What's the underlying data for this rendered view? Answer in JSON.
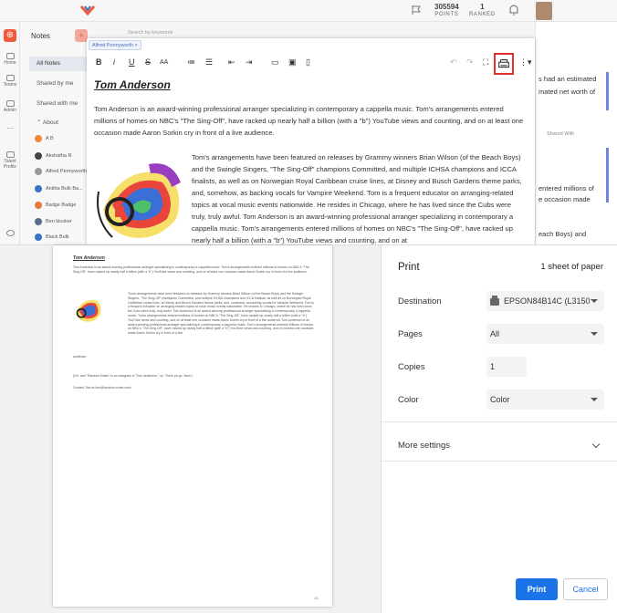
{
  "header": {
    "points_value": "305594",
    "points_label": "POINTS",
    "rank_value": "1",
    "rank_label": "RANKED"
  },
  "leftbar": {
    "items": [
      "Home",
      "Teams",
      "Admin",
      "...",
      "Talent Profile"
    ]
  },
  "sidebar": {
    "title": "Notes",
    "nav": [
      "All Notes",
      "Shared by me",
      "Shared with me"
    ],
    "about_label": "About",
    "users": [
      {
        "initials": "AB",
        "name": "A B",
        "color": "#f08a3b"
      },
      {
        "initials": "AR",
        "name": "Akshatha R",
        "color": "#444"
      },
      {
        "initials": "AP",
        "name": "Alfred Pennyworth",
        "color": "#888"
      },
      {
        "initials": "AB",
        "name": "Anitha Bulk Ba...",
        "color": "#3a72c4"
      },
      {
        "initials": "BB",
        "name": "Badge Badge",
        "color": "#e07b3a"
      },
      {
        "initials": "BK",
        "name": "Ben kiosker",
        "color": "#5a6a8a"
      },
      {
        "initials": "BB",
        "name": "Black Bulk",
        "color": "#3a72c4"
      }
    ]
  },
  "search_placeholder": "Search by keywords",
  "right_pane": {
    "line1": "s had an estimated",
    "line2": "mated net worth of",
    "shared_with": "Shared With",
    "line3": "entered millions of",
    "line4": "e occasion made",
    "line5": "each Boys) and"
  },
  "editor": {
    "chip": "Alfred Pennyworth",
    "toolbar": {
      "bold": "B",
      "italic": "i",
      "underline": "U",
      "strike": "S",
      "fontsize": "AA"
    },
    "title": "Tom Anderson",
    "para1": "Tom Anderson is an award-winning professional arranger specializing in contemporary a cappella music. Tom's arrangements entered millions of homes on NBC's \"The Sing-Off\", have racked up nearly half a billion (with a \"b\") YouTube views and counting, and on at least one occasion made Aaron Sorkin cry in front of a live audience.",
    "para2": "Tom's arrangements have been featured on releases by Grammy winners Brian Wilson (of the Beach Boys) and the Swingle Singers, \"The Sing-Off\" champions Committed, and multiple ICHSA champions and ICCA finalists, as well as on Norwegian Royal Caribbean cruise lines, at Disney and Busch Gardens theme parks, and, somehow, as backing vocals for Vampire Weekend. Tom is a frequent educator on arranging-related topics at vocal music events nationwide. He resides in Chicago, where he has lived since the Cubs were truly, truly awful. Tom Anderson is an award-winning professional arranger specializing in contemporary a cappella music. Tom's arrangements entered millions of homes on NBC's \"The Sing-Off\", have racked up nearly half a billion (with a \"b\") YouTube views and counting, and on at"
  },
  "preview": {
    "title": "Tom Anderson",
    "para1": "Tom Anderson is an award-winning professional arranger specializing in contemporary a cappella music. Tom's arrangements entered millions of homes on NBC's \"The Sing-Off\", have racked up nearly half a billion (with a \"b\") YouTube views and counting, and on at least one occasion made Aaron Sorkin cry in front of a live audience.",
    "para2": "Tom's arrangements have been featured on releases by Grammy winners Brian Wilson (of the Beach Boys) and the Swingle Singers, \"The Sing-Off\" champions Committed, and multiple ICHSA champions and ICCA finalists, as well as on Norwegian Royal Caribbean cruise lines, at Disney and Busch Gardens theme parks, and, somehow, as backing vocals for Vampire Weekend. Tom is a frequent educator on arranging-related topics at vocal music events nationwide. He resides in Chicago, where he has lived since the Cubs were truly, truly awful. Tom Anderson is an award-winning professional arranger specializing in contemporary a cappella music. Tom's arrangements entered millions of homes on NBC's \"The Sing-Off\", have racked up nearly half a billion (with a \"b\") YouTube views and counting, and on at least one occasion made Aaron Sorkin cry in front of a live audience.Tom Anderson is an award-winning professional arranger specializing in contemporary a cappella music. Tom's arrangements entered millions of homes on NBC's \"The Sing-Off\", have racked up nearly half a billion (with a \"b\") YouTube views and counting, and on at least one occasion made Aaron Sorkin cry in front of a live",
    "para2_end": "audience.",
    "para3": "(Oh, and \"Random Notes\" is an anagram of \"Tom Anderson\", so. There ya go. Bam.)",
    "para4": "Contact Tom at tom@random-notes.com!",
    "page_number": "1/1"
  },
  "print_settings": {
    "title": "Print",
    "sheets": "1 sheet of paper",
    "destination_label": "Destination",
    "destination_value": "EPSON84B14C (L3150",
    "pages_label": "Pages",
    "pages_value": "All",
    "copies_label": "Copies",
    "copies_value": "1",
    "color_label": "Color",
    "color_value": "Color",
    "more_settings": "More settings",
    "print_button": "Print",
    "cancel_button": "Cancel"
  },
  "colors": {
    "accent": "#1a73e8",
    "brand": "#f05a3b",
    "highlight": "#e0312c"
  }
}
